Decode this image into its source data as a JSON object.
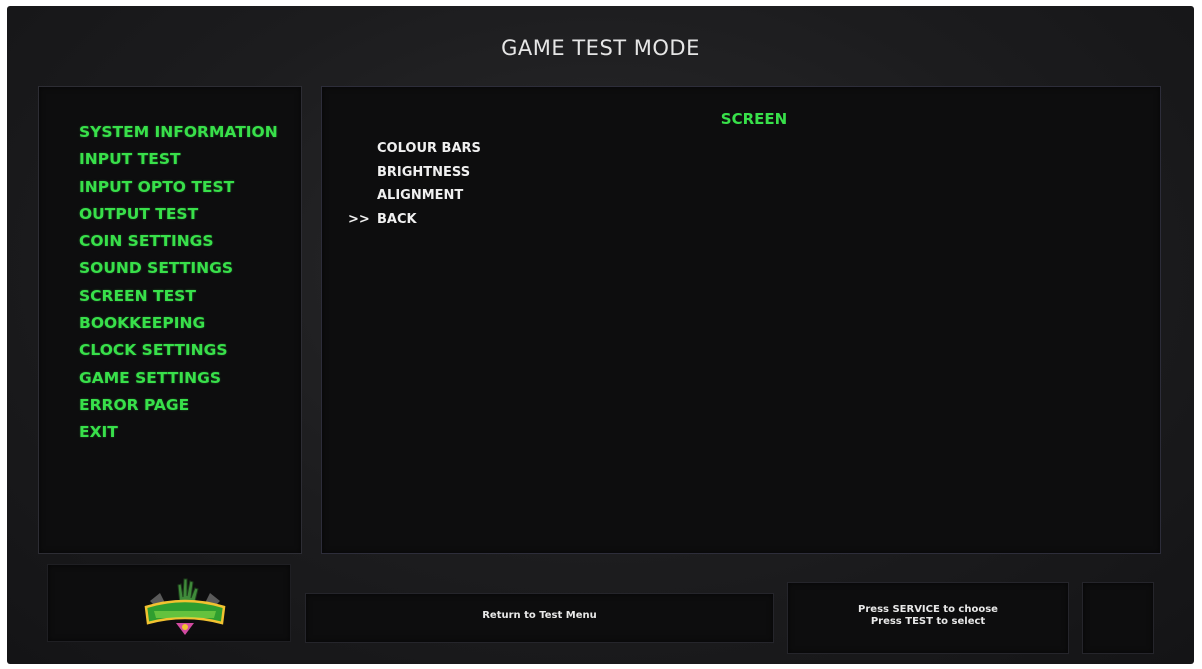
{
  "header": {
    "title": "GAME TEST MODE"
  },
  "sidebar": {
    "items": [
      {
        "label": "SYSTEM INFORMATION"
      },
      {
        "label": "INPUT TEST"
      },
      {
        "label": "INPUT OPTO TEST"
      },
      {
        "label": "OUTPUT TEST"
      },
      {
        "label": "COIN SETTINGS"
      },
      {
        "label": "SOUND SETTINGS"
      },
      {
        "label": "SCREEN TEST"
      },
      {
        "label": "BOOKKEEPING"
      },
      {
        "label": "CLOCK SETTINGS"
      },
      {
        "label": "GAME SETTINGS"
      },
      {
        "label": "ERROR PAGE"
      },
      {
        "label": "EXIT"
      }
    ],
    "color": "#38e04a"
  },
  "main": {
    "section_title": "SCREEN",
    "cursor": ">>",
    "selected_index": 3,
    "items": [
      {
        "label": "COLOUR BARS"
      },
      {
        "label": "BRIGHTNESS"
      },
      {
        "label": "ALIGNMENT"
      },
      {
        "label": "BACK"
      }
    ]
  },
  "footer": {
    "logo_icon": "zombies-game-logo-icon",
    "message": "Return to Test Menu",
    "help_line1": "Press SERVICE to choose",
    "help_line2": "Press TEST to select"
  }
}
